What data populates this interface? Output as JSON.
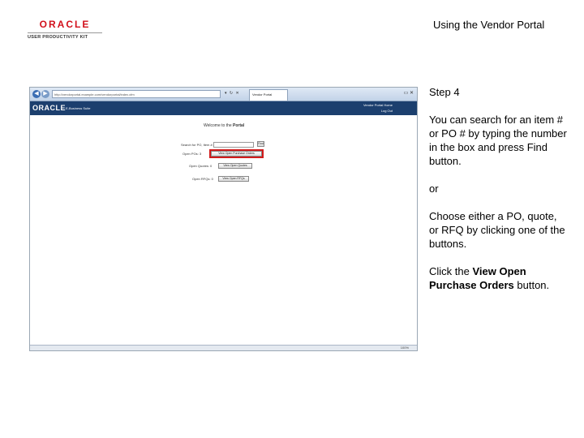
{
  "header": {
    "logo_main": "ORACLE",
    "logo_sub": "USER PRODUCTIVITY KIT",
    "doc_title": "Using the Vendor Portal"
  },
  "instructions": {
    "step": "Step 4",
    "para1": "You can search for an item # or PO # by typing the number in the box and press Find button.",
    "or": "or",
    "para2": "Choose either a PO, quote, or RFQ by clicking one of the buttons.",
    "click_prefix": "Click the ",
    "click_target": "View Open Purchase Orders",
    "click_suffix": " button."
  },
  "browser": {
    "address": "http://vendorportal.example.com/vendorportal/index.cfm",
    "tab_label": "Vendor Portal",
    "app_logo": "ORACLE",
    "app_name": "E-Business Suite",
    "user_label": "Vendor Portal Home",
    "logout_label": "Log Out",
    "welcome_prefix": "Welcome to the ",
    "welcome_bold": "Portal",
    "search_label": "Search for PO, Item # / Vendor Item:",
    "find_label": "Find",
    "open_pos_label": "Open POs: 3",
    "open_pos_button": "View Open Purchase Orders",
    "open_quotes_label": "Open Quotes: 0",
    "open_quotes_button": "View Open Quotes",
    "open_rfqs_label": "Open RFQs: 0",
    "open_rfqs_button": "View Open RFQs",
    "zoom": "100%"
  }
}
